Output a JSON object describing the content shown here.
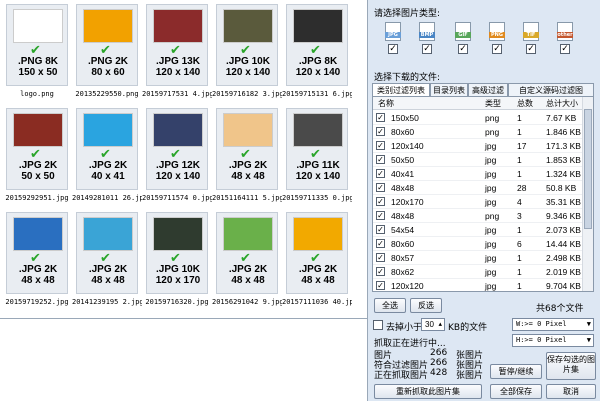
{
  "thumbnails": [
    {
      "fmt": ".PNG 8K",
      "dim": "150 x 50",
      "file": "logo.png",
      "color": "#ffffff"
    },
    {
      "fmt": ".PNG 2K",
      "dim": "80 x 60",
      "file": "20135229550.png",
      "color": "#f2a100"
    },
    {
      "fmt": ".JPG 13K",
      "dim": "120 x 140",
      "file": "20159717531 4.jpg",
      "color": "#8b2b2b"
    },
    {
      "fmt": ".JPG 10K",
      "dim": "120 x 140",
      "file": "20159716182 3.jpg",
      "color": "#5a5a3c"
    },
    {
      "fmt": ".JPG 8K",
      "dim": "120 x 140",
      "file": "20159715131 6.jpg",
      "color": "#2d2d2d"
    },
    {
      "fmt": ".JPG 2K",
      "dim": "50 x 50",
      "file": "20159292951.jpg",
      "color": "#8a2c22"
    },
    {
      "fmt": ".JPG 2K",
      "dim": "40 x 41",
      "file": "20149281011 26.jpg",
      "color": "#2aa4e0"
    },
    {
      "fmt": ".JPG 12K",
      "dim": "120 x 140",
      "file": "20159711574 0.jpg",
      "color": "#34416a"
    },
    {
      "fmt": ".JPG 2K",
      "dim": "48 x 48",
      "file": "20151164111 5.jpg",
      "color": "#f0c58a"
    },
    {
      "fmt": ".JPG 11K",
      "dim": "120 x 140",
      "file": "20159711335 0.jpg",
      "color": "#4a4a4a"
    },
    {
      "fmt": ".JPG 2K",
      "dim": "48 x 48",
      "file": "20159719252.jpg",
      "color": "#2a6fc0"
    },
    {
      "fmt": ".JPG 2K",
      "dim": "48 x 48",
      "file": "20141239195 2.jpg",
      "color": "#3aa4d6"
    },
    {
      "fmt": ".JPG 10K",
      "dim": "120 x 170",
      "file": "20159716320.jpg",
      "color": "#2f3b2f"
    },
    {
      "fmt": ".JPG 2K",
      "dim": "48 x 48",
      "file": "20156291042 9.jpg",
      "color": "#6ab04a"
    },
    {
      "fmt": ".JPG 2K",
      "dim": "48 x 48",
      "file": "20157111036 40.jpg",
      "color": "#f2a900"
    }
  ],
  "panel": {
    "type_title": "请选择图片类型:",
    "file_types": [
      {
        "name": "jpg-icon",
        "label": "JPG",
        "color": "#6a9fd8"
      },
      {
        "name": "bmp-icon",
        "label": "BMP",
        "color": "#4a86c5"
      },
      {
        "name": "gif-icon",
        "label": "GIF",
        "color": "#58a65a"
      },
      {
        "name": "png-icon",
        "label": "PNG",
        "color": "#e08a1e"
      },
      {
        "name": "tif-icon",
        "label": "TIF",
        "color": "#d9a82a"
      },
      {
        "name": "other-icon",
        "label": "other",
        "color": "#c4572e"
      }
    ],
    "files_title": "选择下载的文件:",
    "tabs": [
      "类别过滤列表",
      "目录列表",
      "高级过滤",
      "自定义源码过滤图"
    ],
    "columns": [
      "名称",
      "类型",
      "总数",
      "总计大小"
    ],
    "rows": [
      [
        "150x50",
        "png",
        "1",
        "7.67 KB"
      ],
      [
        "80x60",
        "png",
        "1",
        "1.846 KB"
      ],
      [
        "120x140",
        "jpg",
        "17",
        "171.3 KB"
      ],
      [
        "50x50",
        "jpg",
        "1",
        "1.853 KB"
      ],
      [
        "40x41",
        "jpg",
        "1",
        "1.324 KB"
      ],
      [
        "48x48",
        "jpg",
        "28",
        "50.8 KB"
      ],
      [
        "120x170",
        "jpg",
        "4",
        "35.31 KB"
      ],
      [
        "48x48",
        "png",
        "3",
        "9.346 KB"
      ],
      [
        "54x54",
        "jpg",
        "1",
        "2.073 KB"
      ],
      [
        "80x60",
        "jpg",
        "6",
        "14.44 KB"
      ],
      [
        "80x57",
        "jpg",
        "1",
        "2.498 KB"
      ],
      [
        "80x62",
        "jpg",
        "1",
        "2.019 KB"
      ],
      [
        "120x120",
        "jpg",
        "1",
        "9.704 KB"
      ]
    ],
    "select_all": "全选",
    "invert": "反选",
    "total": "共68个文件",
    "remove_small_label": "去掉小于",
    "remove_small_value": "30",
    "remove_small_unit": "KB的文件",
    "width_filter": "W:>= 0 Pixel",
    "height_filter": "H:>= 0 Pixel",
    "status_title": "抓取正在进行中...",
    "stats": [
      {
        "label": "图片",
        "value": "266",
        "unit": "张图片"
      },
      {
        "label": "符合过滤图片",
        "value": "266",
        "unit": "张图片"
      },
      {
        "label": "正在抓取图片",
        "value": "428",
        "unit": "张图片"
      }
    ],
    "pause_button": "暂停/继续",
    "save_selected_button": "保存勾选的图片集",
    "recapture_button": "重新抓取此图片集",
    "save_all_button": "全部保存",
    "cancel_button": "取消"
  }
}
